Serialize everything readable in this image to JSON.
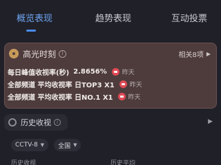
{
  "tabs": [
    {
      "label": "概览表现",
      "active": true
    },
    {
      "label": "趋势表现",
      "active": false
    },
    {
      "label": "互动投票",
      "active": false
    }
  ],
  "highlights": {
    "title": "高光时刻",
    "related": "相关8项",
    "rows": [
      {
        "text": "每日峰值收视率(秒)",
        "value": "2.8656%",
        "day": "昨天"
      },
      {
        "text": "全部频道 平均收视率 日TOP3 X1",
        "value": "",
        "day": "昨天"
      },
      {
        "text": "全部频道 平均收视率 日NO.1 X1",
        "value": "",
        "day": "昨天"
      }
    ]
  },
  "history": {
    "title": "历史收视",
    "channel_select": "CCTV-8",
    "region_select": "全国",
    "columns": [
      "历史收视",
      "历史平均"
    ]
  },
  "colors": {
    "accent": "#4a8cf0",
    "background": "#202028",
    "highlight_card": "#4e3c3d",
    "badge": "#e04a55"
  }
}
